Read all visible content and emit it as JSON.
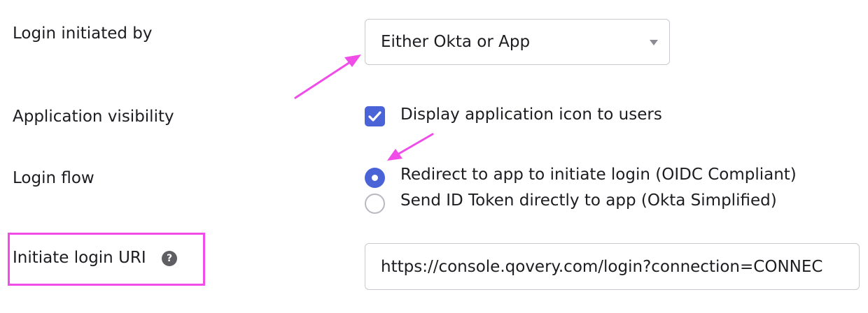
{
  "form": {
    "login_initiated_by": {
      "label": "Login initiated by",
      "selected": "Either Okta or App"
    },
    "application_visibility": {
      "label": "Application visibility",
      "option_label": "Display application icon to users",
      "checked": true
    },
    "login_flow": {
      "label": "Login flow",
      "options": [
        {
          "label": "Redirect to app to initiate login (OIDC Compliant)",
          "selected": true
        },
        {
          "label": "Send ID Token directly to app (Okta Simplified)",
          "selected": false
        }
      ]
    },
    "initiate_login_uri": {
      "label": "Initiate login URI",
      "value": "https://console.qovery.com/login?connection=CONNEC",
      "help_icon": "question-mark-icon"
    }
  },
  "annotations": {
    "color": "#f04ce8",
    "arrows": [
      "arrow-to-dropdown",
      "arrow-to-radio"
    ],
    "highlight": "box-around-initiate-login-uri"
  },
  "colors": {
    "accent": "#4a64d8",
    "text": "#1d1d21",
    "border": "#c9c9d0"
  }
}
